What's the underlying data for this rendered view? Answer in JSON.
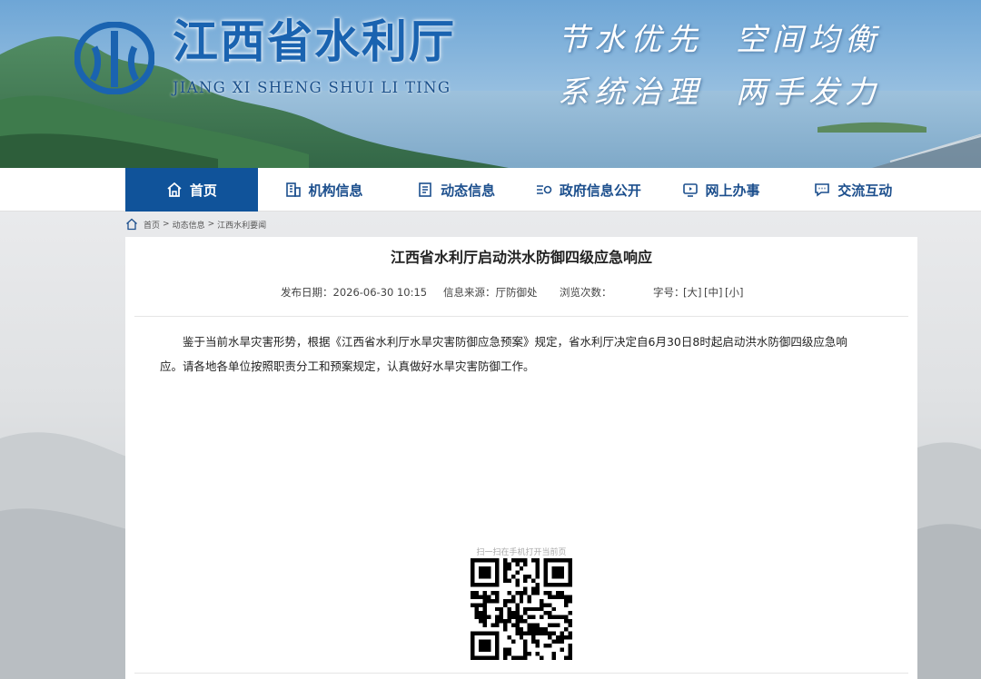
{
  "site": {
    "title": "江西省水利厅",
    "subtitle": "JIANG XI SHENG SHUI LI TING",
    "slogans": [
      "节水优先",
      "空间均衡",
      "系统治理",
      "两手发力"
    ]
  },
  "nav": {
    "items": [
      {
        "label": "首页",
        "icon": "home-icon"
      },
      {
        "label": "机构信息",
        "icon": "building-icon"
      },
      {
        "label": "动态信息",
        "icon": "news-icon"
      },
      {
        "label": "政府信息公开",
        "icon": "list-icon"
      },
      {
        "label": "网上办事",
        "icon": "monitor-icon"
      },
      {
        "label": "交流互动",
        "icon": "chat-icon"
      }
    ]
  },
  "breadcrumb": {
    "items": [
      "首页",
      ">",
      "动态信息",
      ">",
      "江西水利要闻"
    ]
  },
  "article": {
    "title": "江西省水利厅启动洪水防御四级应急响应",
    "meta": {
      "date": "发布日期：2026-06-30 10:15",
      "source": "信息来源：厅防御处",
      "views": "浏览次数：",
      "font_label": "字号：",
      "size_large": "[大]",
      "size_medium": "[中]",
      "size_small": "[小]"
    },
    "para1": "鉴于当前水旱灾害形势，根据《江西省水利厅水旱灾害防御应急预案》规定，省水利厅决定自6月30日8时起启动洪水防御四级应急响",
    "para2": "应。请各地各单位按照职责分工和预案规定，认真做好水旱灾害防御工作。"
  },
  "qr": {
    "caption": "扫一扫在手机打开当前页"
  },
  "colors": {
    "nav_active": "#10539a",
    "nav_text": "#1c4f8d",
    "title_blue": "#1a63b0"
  }
}
